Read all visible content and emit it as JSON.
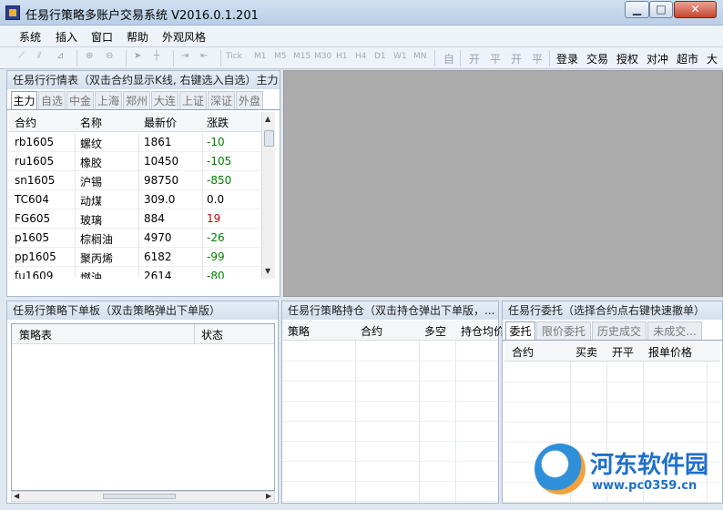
{
  "window": {
    "title": "任易行策略多账户交易系统 V2016.0.1.201"
  },
  "menu": [
    "系统",
    "插入",
    "窗口",
    "帮助",
    "外观风格"
  ],
  "toolbar": {
    "periods": [
      "Tick",
      "M1",
      "M5",
      "M15",
      "M30",
      "H1",
      "H4",
      "D1",
      "W1",
      "MN"
    ],
    "modes": [
      "自",
      "开",
      "平",
      "开",
      "平"
    ],
    "actions": [
      "登录",
      "交易",
      "授权",
      "对冲",
      "超市",
      "大"
    ]
  },
  "quotes": {
    "title": "任易行行情表（双击合约显示K线, 右键选入自选）主力",
    "tabs": [
      "主力",
      "自选",
      "中金",
      "上海",
      "郑州",
      "大连",
      "上证",
      "深证",
      "外盘"
    ],
    "columns": [
      "合约",
      "名称",
      "最新价",
      "涨跌"
    ],
    "rows": [
      {
        "contract": "rb1605",
        "name": "螺纹",
        "price": "1861",
        "change": "-10",
        "dir": "down"
      },
      {
        "contract": "ru1605",
        "name": "橡胶",
        "price": "10450",
        "change": "-105",
        "dir": "down"
      },
      {
        "contract": "sn1605",
        "name": "沪锡",
        "price": "98750",
        "change": "-850",
        "dir": "down"
      },
      {
        "contract": "TC604",
        "name": "动煤",
        "price": "309.0",
        "change": "0.0",
        "dir": "flat"
      },
      {
        "contract": "FG605",
        "name": "玻璃",
        "price": "884",
        "change": "19",
        "dir": "up"
      },
      {
        "contract": "p1605",
        "name": "棕榈油",
        "price": "4970",
        "change": "-26",
        "dir": "down"
      },
      {
        "contract": "pp1605",
        "name": "聚丙烯",
        "price": "6182",
        "change": "-99",
        "dir": "down"
      },
      {
        "contract": "fu1609",
        "name": "燃油",
        "price": "2614",
        "change": "-80",
        "dir": "down"
      }
    ]
  },
  "strategy_panel": {
    "title": "任易行策略下单板（双击策略弹出下单版）",
    "columns": [
      "策略表",
      "状态"
    ]
  },
  "positions_panel": {
    "title": "任易行策略持仓（双击持仓弹出下单版，...",
    "columns": [
      "策略",
      "合约",
      "多空",
      "持仓均价"
    ]
  },
  "orders_panel": {
    "title": "任易行委托（选择合约点右键快速撤单）",
    "tabs": [
      "委托",
      "限价委托",
      "历史成交",
      "未成交..."
    ],
    "columns": [
      "合约",
      "买卖",
      "开平",
      "报单价格"
    ]
  },
  "watermark": {
    "name": "河东软件园",
    "url": "www.pc0359.cn"
  },
  "colors": {
    "down": "#008000",
    "up": "#c00000",
    "chart_bg": "#ababab"
  }
}
